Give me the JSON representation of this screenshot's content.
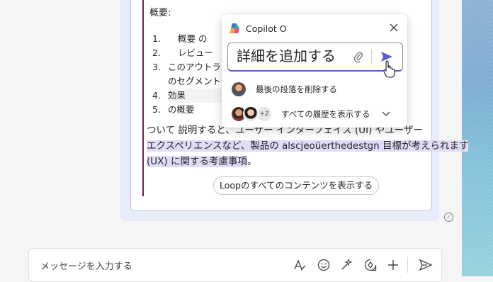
{
  "loop": {
    "summary_label": "概要:",
    "outline": [
      {
        "num": "1.",
        "text": "概要 の"
      },
      {
        "num": "2.",
        "text": "レビュー"
      },
      {
        "num": "3.",
        "text": "このアウトライン"
      },
      {
        "num": "",
        "text": "のセグメント化に"
      },
      {
        "num": "4.",
        "text": "効果"
      },
      {
        "num": "5.",
        "text": "の概要"
      }
    ],
    "paragraph": {
      "line1": "ついて 説明すると、ユーザー インターフェイス (UI) やユーザー",
      "line2": "エクスペリエンスなど、製品の alscjeoüerthedestgn 目標が考えられます",
      "line3_highlight": "(UX) に関する考慮事項",
      "line3_end": "。"
    },
    "see_all_button": "Loopのすべてのコンテンツを表示する"
  },
  "copilot": {
    "title": "Copilot O",
    "input_value": "詳細を追加する",
    "suggestion_1": "最後の段落を削除する",
    "history_extra": "+2",
    "suggestion_2": "すべての履歴を表示する"
  },
  "compose": {
    "placeholder": "メッセージを入力する"
  },
  "colors": {
    "accent": "#5b5fc7",
    "highlight": "#e2dbf7",
    "bubble": "#e8ebfa"
  }
}
